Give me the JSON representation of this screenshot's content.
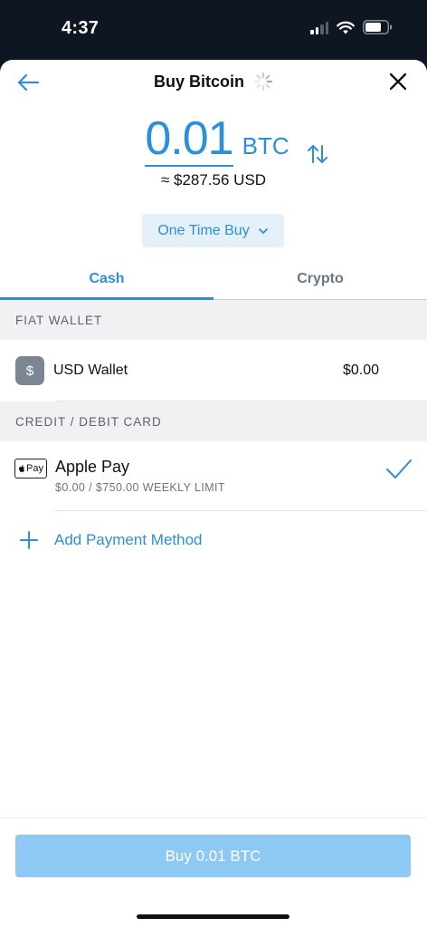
{
  "status_bar": {
    "time": "4:37",
    "icons": [
      "cellular-signal-icon",
      "wifi-icon",
      "battery-icon"
    ]
  },
  "header": {
    "title": "Buy Bitcoin",
    "icons": [
      "back-arrow-icon",
      "loading-spinner-icon",
      "close-icon"
    ]
  },
  "amount": {
    "value": "0.01",
    "unit": "BTC",
    "usd_equivalent": "≈ $287.56 USD",
    "swap_icon": "swap-arrows-icon"
  },
  "frequency": {
    "label": "One Time Buy",
    "icon": "chevron-down-icon"
  },
  "tabs": [
    {
      "label": "Cash",
      "active": true
    },
    {
      "label": "Crypto",
      "active": false
    }
  ],
  "sections": {
    "fiat_wallet": {
      "header": "FIAT WALLET",
      "wallet": {
        "icon_symbol": "$",
        "name": "USD Wallet",
        "balance": "$0.00"
      }
    },
    "cards": {
      "header": "CREDIT / DEBIT CARD",
      "method": {
        "logo_text": "Pay",
        "name": "Apple Pay",
        "limit": "$0.00 / $750.00 WEEKLY LIMIT",
        "selected": true
      }
    }
  },
  "add_payment": {
    "label": "Add Payment Method",
    "icon": "plus-icon"
  },
  "buy_button": {
    "label": "Buy 0.01 BTC",
    "enabled": false
  },
  "colors": {
    "accent": "#2d8fd5",
    "accent_light": "#e4f1fb",
    "button_disabled": "#8ec9f3",
    "status_bar_bg": "#0e1622",
    "muted_text": "#6c7580"
  }
}
